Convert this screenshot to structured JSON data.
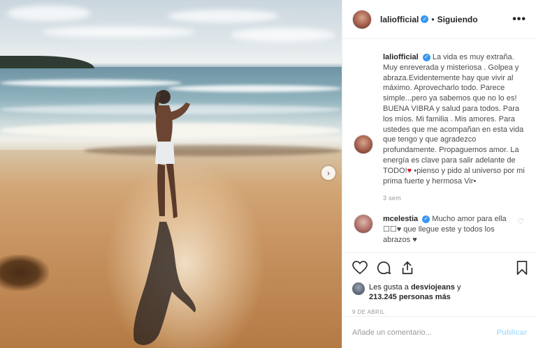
{
  "post": {
    "next_icon": "chevron-right-icon"
  },
  "header": {
    "username": "laliofficial",
    "separator": "•",
    "follow_status": "Siguiendo",
    "more_icon": "•••"
  },
  "caption": {
    "username": "laliofficial",
    "text_before_heart": "La vida es muy extraña. Muy enreverada y misteriosa . Golpea y abraza.Evidentemente hay que vivir al máximo. Aprovecharlo todo. Parece simple...pero ya sabemos que no lo es! BUENA VIBRA y salud para todos. Para los míos. Mi familia . Mis amores. Para ustedes que me acompañan en esta vida que tengo y que agradezco profundamente. Propaguemos amor. La energía es clave para salir adelante de TODO!",
    "heart": "♥",
    "text_after_heart": " •pienso y pido al universo por mi prima fuerte y hermosa Vir•",
    "time": "3 sem"
  },
  "reply": {
    "username": "mcelestia",
    "text": "Mucho amor para ella ☐☐♥ que llegue este y todos los abrazos ♥",
    "heart_icon": "♡"
  },
  "actions": {
    "liked_by_prefix": "Les gusta a ",
    "liked_by_user": "desviojeans",
    "liked_by_mid": " y ",
    "likes_count": "213.245 personas más",
    "date": "9 DE ABRIL"
  },
  "comment_box": {
    "placeholder": "Añade un comentario...",
    "publish": "Publicar"
  },
  "colors": {
    "verified": "#3897f0",
    "publish_disabled": "#b2dffc",
    "heart": "#d9162b"
  }
}
